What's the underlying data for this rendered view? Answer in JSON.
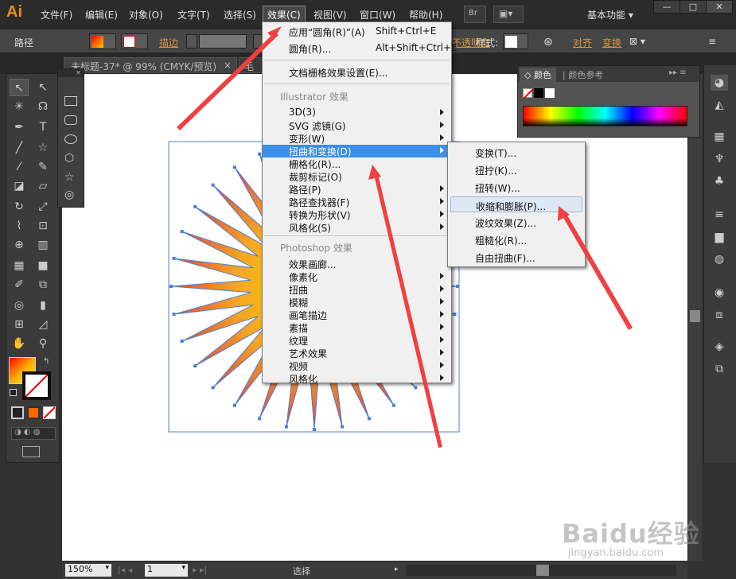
{
  "app": {
    "logo": "Ai",
    "workspace": "基本功能",
    "br_label": "Br"
  },
  "menubar": {
    "items": [
      {
        "label": "文件(F)"
      },
      {
        "label": "编辑(E)"
      },
      {
        "label": "对象(O)"
      },
      {
        "label": "文字(T)"
      },
      {
        "label": "选择(S)"
      },
      {
        "label": "效果(C)"
      },
      {
        "label": "视图(V)"
      },
      {
        "label": "窗口(W)"
      },
      {
        "label": "帮助(H)"
      }
    ]
  },
  "window_controls": {
    "minimize": "—",
    "maximize": "□",
    "close": "✕"
  },
  "control_bar": {
    "object_type": "路径",
    "stroke_label": "描边",
    "opacity_label": "不透明度",
    "style_label": "样式:",
    "align_label": "对齐",
    "transform_label": "变换"
  },
  "document_tab": {
    "title": "未标题-37* @ 99% (CMYK/预览)",
    "close": "×",
    "second_tab": "毛"
  },
  "effect_menu": {
    "apply_last": {
      "label": "应用“圆角(R)”(A)",
      "shortcut": "Shift+Ctrl+E"
    },
    "last_effect": {
      "label": "圆角(R)...",
      "shortcut": "Alt+Shift+Ctrl+E"
    },
    "doc_raster": "文档栅格效果设置(E)...",
    "illustrator_header": "Illustrator 效果",
    "illustrator_items": [
      "3D(3)",
      "SVG 滤镜(G)",
      "变形(W)",
      "扭曲和变换(D)",
      "栅格化(R)...",
      "裁剪标记(O)",
      "路径(P)",
      "路径查找器(F)",
      "转换为形状(V)",
      "风格化(S)"
    ],
    "photoshop_header": "Photoshop 效果",
    "photoshop_items": [
      "效果画廊...",
      "像素化",
      "扭曲",
      "模糊",
      "画笔描边",
      "素描",
      "纹理",
      "艺术效果",
      "视频",
      "风格化"
    ]
  },
  "submenu": {
    "items": [
      "变换(T)...",
      "扭拧(K)...",
      "扭转(W)...",
      "收缩和膨胀(P)...",
      "波纹效果(Z)...",
      "粗糙化(R)...",
      "自由扭曲(F)..."
    ]
  },
  "color_panel": {
    "tab_color": "颜色",
    "tab_guide": "颜色参考"
  },
  "statusbar": {
    "zoom": "150%",
    "artboard": "1",
    "tool": "选择"
  },
  "watermark": {
    "brand": "Baidu经验",
    "url": "jingyan.baidu.com"
  },
  "colors": {
    "accent": "#3b8fe8",
    "arrow": "#f04040",
    "star_orange": "#f5a623",
    "star_red": "#e0483a"
  }
}
